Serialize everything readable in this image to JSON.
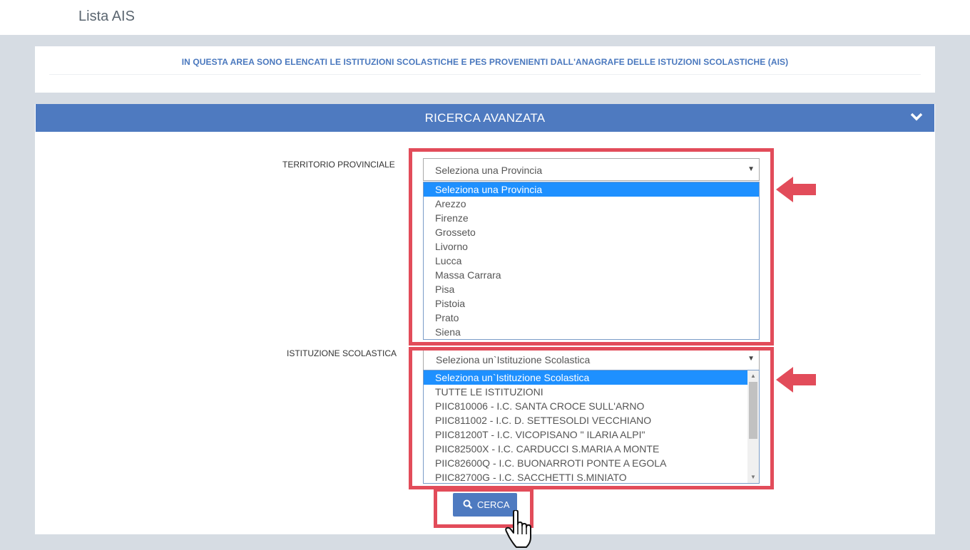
{
  "header": {
    "title": "Lista AIS"
  },
  "info": {
    "text": "IN QUESTA AREA SONO ELENCATI LE ISTITUZIONI SCOLASTICHE E PES PROVENIENTI DALL'ANAGRAFE DELLE ISTUZIONI SCOLASTICHE (AIS)"
  },
  "search": {
    "title": "RICERCA AVANZATA",
    "provincia": {
      "label": "TERRITORIO PROVINCIALE",
      "selected": "Seleziona una Provincia",
      "options": [
        "Seleziona una Provincia",
        "Arezzo",
        "Firenze",
        "Grosseto",
        "Livorno",
        "Lucca",
        "Massa Carrara",
        "Pisa",
        "Pistoia",
        "Prato",
        "Siena"
      ]
    },
    "istituzione": {
      "label": "ISTITUZIONE SCOLASTICA",
      "selected": "Seleziona un`Istituzione Scolastica",
      "options": [
        "Seleziona un`Istituzione Scolastica",
        "TUTTE LE ISTITUZIONI",
        "PIIC810006 - I.C. SANTA CROCE SULL'ARNO",
        "PIIC811002 - I.C. D. SETTESOLDI VECCHIANO",
        "PIIC81200T - I.C. VICOPISANO \" ILARIA ALPI\"",
        "PIIC82500X - I.C. CARDUCCI S.MARIA A MONTE",
        "PIIC82600Q - I.C. BUONARROTI PONTE A EGOLA",
        "PIIC82700G - I.C. SACCHETTI S.MINIATO"
      ]
    },
    "button_label": "CERCA"
  },
  "colors": {
    "accent": "#4e7ac0",
    "highlight": "#e24c5a",
    "selected_option": "#1e90ff"
  },
  "icons": {
    "collapse": "chevron-down-icon",
    "search": "search-icon",
    "cursor": "hand-pointer-icon",
    "annotation": "arrow-left-icon"
  }
}
